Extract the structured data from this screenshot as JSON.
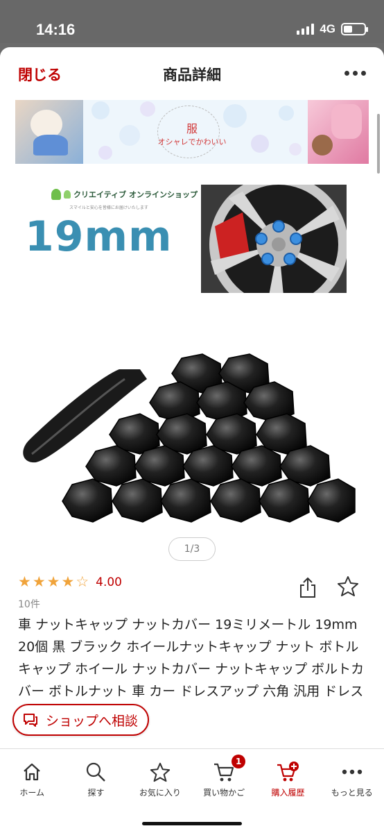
{
  "status": {
    "time": "14:16",
    "network": "4G"
  },
  "header": {
    "close": "閉じる",
    "title": "商品詳細"
  },
  "banner": {
    "kanji": "服",
    "subtitle": "オシャレでかわいい"
  },
  "product_image": {
    "shop_name": "クリエイティブ オンラインショップ",
    "shop_tagline": "スマイルと安心を皆様にお届けいたします",
    "size_label": "19mm"
  },
  "pager": "1/3",
  "rating": {
    "stars": 4,
    "max": 5,
    "value": "4.00",
    "count": "10件"
  },
  "product_title": "車 ナットキャップ ナットカバー 19ミリメートル 19mm 20個 黒 ブラック ホイールナットキャップ ナット ボトルキャップ ホイール ナットカバー ナットキャップ ボルトカバー ボトルナット 車 カー ドレスアップ 六角 汎用 ドレスアップ かっこい",
  "consult_button": "ショップへ相談",
  "tabs": [
    {
      "label": "ホーム",
      "icon": "home-icon"
    },
    {
      "label": "探す",
      "icon": "search-icon"
    },
    {
      "label": "お気に入り",
      "icon": "star-icon"
    },
    {
      "label": "買い物かご",
      "icon": "cart-icon",
      "badge": "1"
    },
    {
      "label": "購入履歴",
      "icon": "purchase-history-icon"
    },
    {
      "label": "もっと見る",
      "icon": "more-icon"
    }
  ],
  "colors": {
    "brand": "#bf0000",
    "star": "#f0a33a",
    "size_text": "#3a8fb2"
  }
}
